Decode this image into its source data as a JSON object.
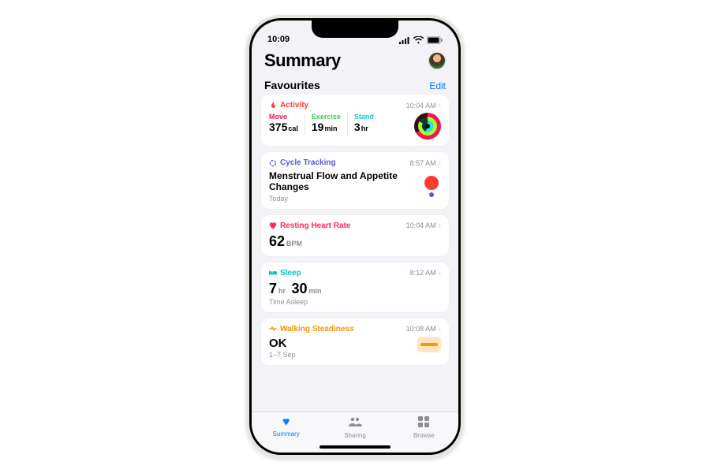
{
  "status": {
    "time": "10:09"
  },
  "header": {
    "title": "Summary"
  },
  "favourites": {
    "title": "Favourites",
    "edit": "Edit"
  },
  "cards": {
    "activity": {
      "title": "Activity",
      "time": "10:04 AM",
      "move_label": "Move",
      "move_value": "375",
      "move_unit": "cal",
      "exercise_label": "Exercise",
      "exercise_value": "19",
      "exercise_unit": "min",
      "stand_label": "Stand",
      "stand_value": "3",
      "stand_unit": "hr"
    },
    "cycle": {
      "title": "Cycle Tracking",
      "time": "8:57 AM",
      "headline": "Menstrual Flow and Appetite Changes",
      "sub": "Today"
    },
    "heart": {
      "title": "Resting Heart Rate",
      "time": "10:04 AM",
      "value": "62",
      "unit": "BPM"
    },
    "sleep": {
      "title": "Sleep",
      "time": "8:12 AM",
      "h": "7",
      "h_unit": "hr",
      "m": "30",
      "m_unit": "min",
      "sub": "Time Asleep"
    },
    "walk": {
      "title": "Walking Steadiness",
      "time": "10:08 AM",
      "value": "OK",
      "sub": "1–7 Sep"
    }
  },
  "tabs": {
    "summary": "Summary",
    "sharing": "Sharing",
    "browse": "Browse"
  }
}
